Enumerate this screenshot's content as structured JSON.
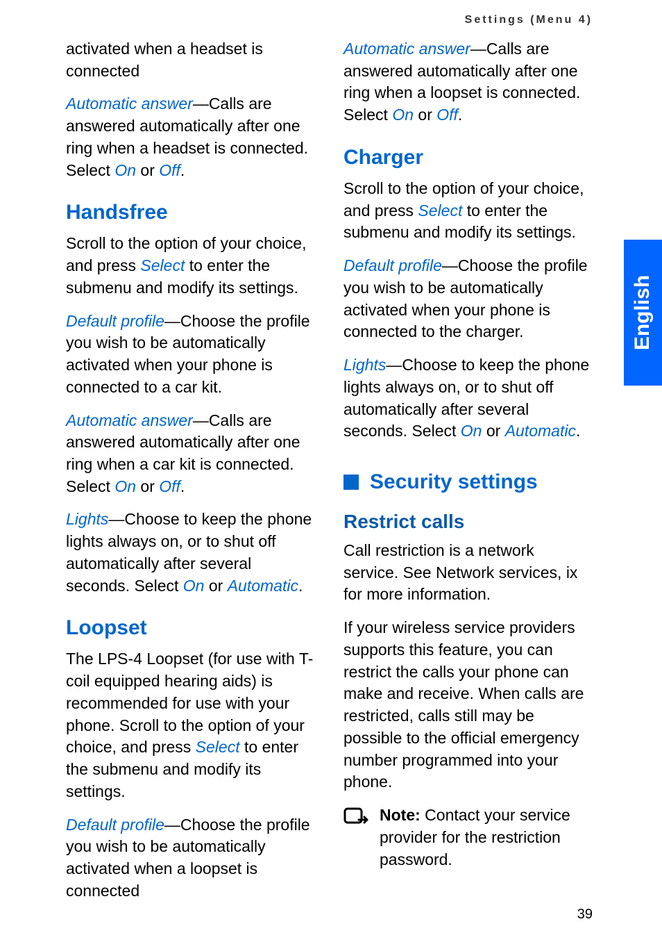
{
  "header": "Settings (Menu 4)",
  "pageNumber": "39",
  "sideTab": "English",
  "col1": {
    "p1_a": "activated when a headset is connected",
    "p2_term": "Automatic answer",
    "p2_rest": "—Calls are answered automatically after one ring when a headset is connected. Select ",
    "p2_on": "On",
    "p2_or": " or ",
    "p2_off": "Off",
    "p2_dot": ".",
    "handsfree_title": "Handsfree",
    "handsfree_p1_a": "Scroll to the option of your choice, and press ",
    "handsfree_p1_select": "Select",
    "handsfree_p1_b": " to enter the submenu and modify its settings.",
    "handsfree_p2_term": "Default profile",
    "handsfree_p2_rest": "—Choose the profile you wish to be automatically activated when your phone is connected to a car kit.",
    "handsfree_p3_term": "Automatic answer",
    "handsfree_p3_rest": "—Calls are answered automatically after one ring when a car kit is connected. Select ",
    "handsfree_p3_on": "On",
    "handsfree_p3_or": " or ",
    "handsfree_p3_off": "Off",
    "handsfree_p3_dot": ".",
    "handsfree_p4_term": "Lights",
    "handsfree_p4_rest": "—Choose to keep the phone lights always on, or to shut off automatically after several seconds. Select ",
    "handsfree_p4_on": "On",
    "handsfree_p4_or": " or ",
    "handsfree_p4_auto": "Automatic",
    "handsfree_p4_dot": ".",
    "loopset_title": "Loopset",
    "loopset_p1_a": "The LPS-4 Loopset (for use with T-coil equipped hearing aids) is recommended for use with your phone. Scroll to the option of your choice, and press ",
    "loopset_p1_select": "Select",
    "loopset_p1_b": " to enter the submenu and modify its settings.",
    "loopset_p2_term": "Default profile",
    "loopset_p2_rest": "—Choose the profile you wish to be automatically activated when a loopset is connected"
  },
  "col2": {
    "p1_term": "Automatic answer",
    "p1_rest": "—Calls are answered automatically after one ring when a loopset is connected. Select ",
    "p1_on": "On",
    "p1_or": " or ",
    "p1_off": "Off",
    "p1_dot": ".",
    "charger_title": "Charger",
    "charger_p1_a": "Scroll to the option of your choice, and press ",
    "charger_p1_select": "Select",
    "charger_p1_b": " to enter the submenu and modify its settings.",
    "charger_p2_term": "Default profile",
    "charger_p2_rest": "—Choose the profile you wish to be automatically activated when your phone is connected to the charger.",
    "charger_p3_term": "Lights",
    "charger_p3_rest": "—Choose to keep the phone lights always on, or to shut off automatically after several seconds. Select ",
    "charger_p3_on": "On",
    "charger_p3_or": " or ",
    "charger_p3_auto": "Automatic",
    "charger_p3_dot": ".",
    "security_title": "Security settings",
    "restrict_title": "Restrict calls",
    "restrict_p1": "Call restriction is a network service. See Network services, ix for more information.",
    "restrict_p2": "If your wireless service providers supports this feature, you can restrict the calls your phone can make and receive. When calls are restricted, calls still may be possible to the official emergency number programmed into your phone.",
    "note_bold": "Note:",
    "note_rest": " Contact your service provider for the restriction password."
  }
}
